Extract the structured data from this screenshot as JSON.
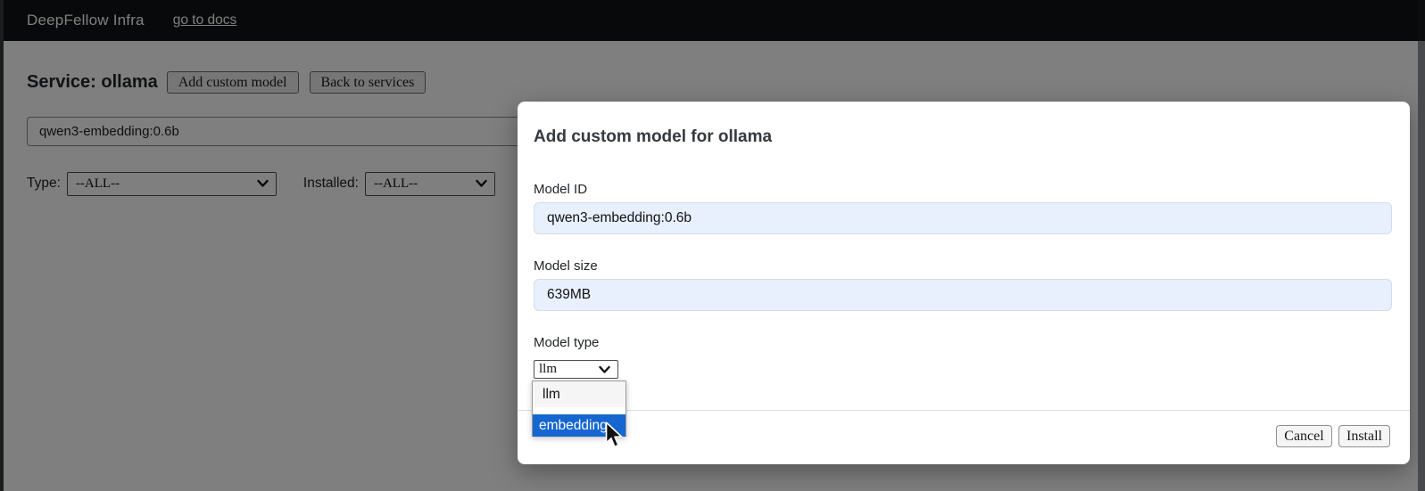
{
  "header": {
    "brand": "DeepFellow Infra",
    "docs_link": "go to docs"
  },
  "page": {
    "service_title": "Service: ollama",
    "add_custom_model_button": "Add custom model",
    "back_to_services_button": "Back to services",
    "search_value": "qwen3-embedding:0.6b",
    "filters": {
      "type_label": "Type:",
      "type_value": "--ALL--",
      "installed_label": "Installed:",
      "installed_value": "--ALL--"
    }
  },
  "modal": {
    "title": "Add custom model for ollama",
    "model_id_label": "Model ID",
    "model_id_value": "qwen3-embedding:0.6b",
    "model_size_label": "Model size",
    "model_size_value": "639MB",
    "model_type_label": "Model type",
    "model_type_value": "llm",
    "model_type_options": [
      "llm",
      "embedding"
    ],
    "highlighted_option": "embedding",
    "cancel_button": "Cancel",
    "install_button": "Install"
  },
  "colors": {
    "header_bg": "#101214",
    "overlay": "rgba(0,0,0,0.5)",
    "autofill_input_bg": "#e8f0fe",
    "option_highlight_bg": "#1566d0",
    "option_highlight_text": "#ffffff"
  }
}
